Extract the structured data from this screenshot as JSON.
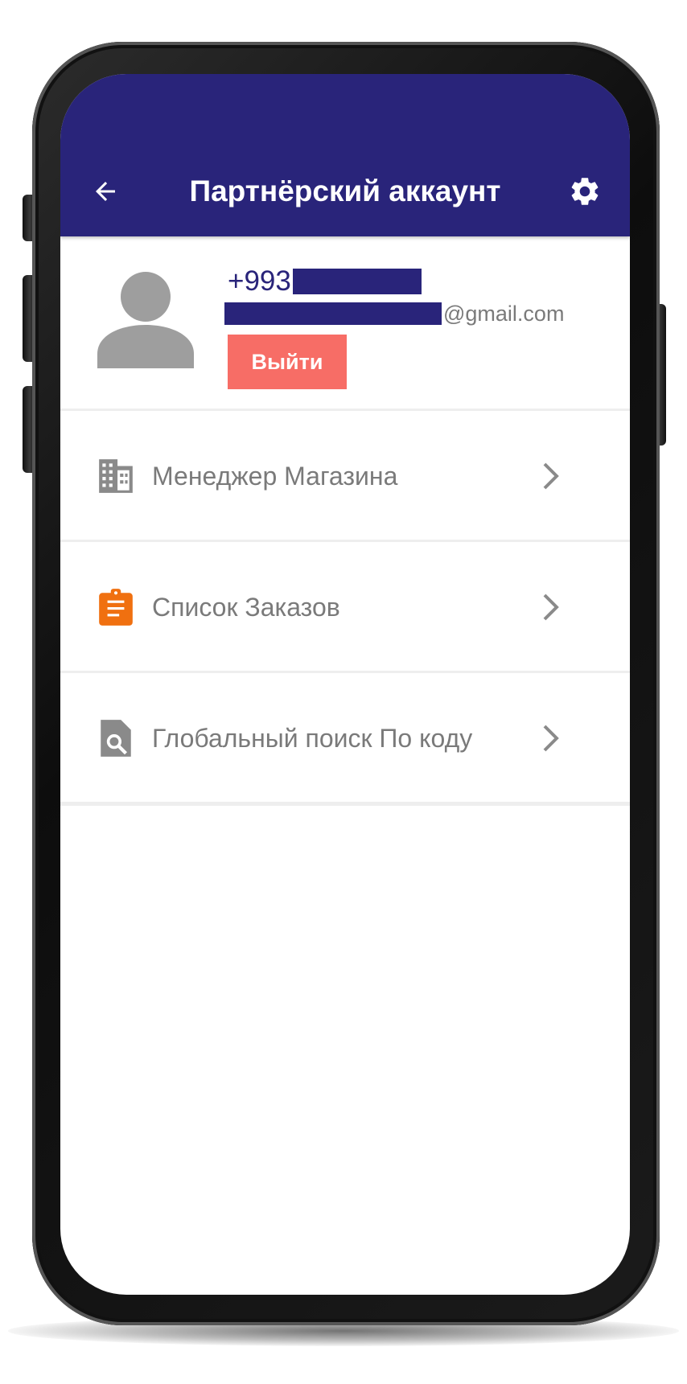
{
  "appbar": {
    "title": "Партнёрский аккаунт",
    "back_icon": "arrow-left-icon",
    "settings_icon": "gear-icon",
    "background_color": "#29247a"
  },
  "profile": {
    "phone_prefix": "+993",
    "email_suffix": "@gmail.com",
    "logout_label": "Выйти",
    "logout_color": "#f76d66",
    "avatar_icon": "person-icon"
  },
  "menu": [
    {
      "label": "Менеджер Магазина",
      "icon": "building-icon"
    },
    {
      "label": "Список Заказов",
      "icon": "clipboard-icon",
      "icon_color": "#f07010"
    },
    {
      "label": "Глобальный поиск По коду",
      "icon": "document-search-icon"
    }
  ]
}
